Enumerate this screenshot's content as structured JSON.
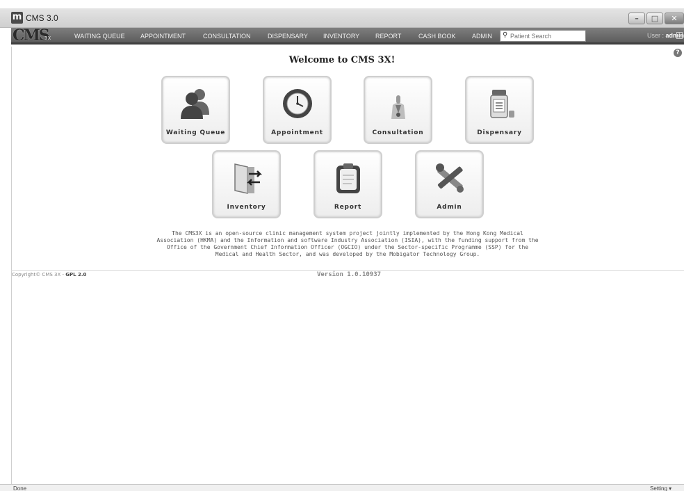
{
  "window": {
    "app_letter": "m",
    "title": "CMS 3.0",
    "min_glyph": "–",
    "max_glyph": "□",
    "close_glyph": "✕"
  },
  "nav": {
    "logo_big": "CMS",
    "logo_small": "3X",
    "items": [
      {
        "label": "WAITING QUEUE"
      },
      {
        "label": "APPOINTMENT"
      },
      {
        "label": "CONSULTATION"
      },
      {
        "label": "DISPENSARY"
      },
      {
        "label": "INVENTORY"
      },
      {
        "label": "REPORT"
      },
      {
        "label": "CASH BOOK"
      },
      {
        "label": "ADMIN"
      }
    ],
    "search_placeholder": "Patient Search",
    "user_prefix": "User : ",
    "user_name": "admin"
  },
  "main": {
    "welcome": "Welcome to CMS 3X!",
    "help_glyph": "?",
    "tiles": [
      {
        "label": "Waiting Queue",
        "icon": "people-icon"
      },
      {
        "label": "Appointment",
        "icon": "clock-icon"
      },
      {
        "label": "Consultation",
        "icon": "doctor-icon"
      },
      {
        "label": "Dispensary",
        "icon": "medicine-bottle-icon"
      },
      {
        "label": "Inventory",
        "icon": "inventory-door-icon"
      },
      {
        "label": "Report",
        "icon": "clipboard-icon"
      },
      {
        "label": "Admin",
        "icon": "tools-icon"
      }
    ],
    "description": "The CMS3X is an open-source clinic management system project jointly implemented by the Hong Kong Medical Association (HKMA) and the Information and software Industry Association (ISIA), with the funding support from the Office of the Government Chief Information Officer (OGCIO) under the Sector-specific Programme (SSP) for the Medical and Health Sector, and was developed by the Mobigator Technology Group."
  },
  "footer": {
    "copyright": "Copyright© CMS 3X - ",
    "license": "GPL 2.0",
    "version": "Version 1.0.10937"
  },
  "status": {
    "text": "Done",
    "setting": "Setting ▾"
  },
  "colors": {
    "nav_bg": "#6b6b6b",
    "tile_border": "#cfcfcf",
    "icon_dark": "#555555"
  }
}
